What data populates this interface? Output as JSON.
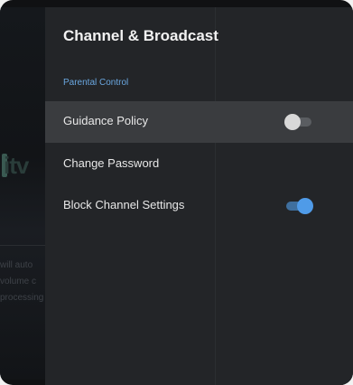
{
  "background": {
    "logo_text": "itv",
    "text_lines": [
      "will auto",
      "volume c",
      "processing"
    ]
  },
  "panel": {
    "title": "Channel & Broadcast",
    "section_label": "Parental Control",
    "items": [
      {
        "label": "Guidance Policy",
        "has_toggle": true,
        "toggle_on": false,
        "focused": true
      },
      {
        "label": "Change Password",
        "has_toggle": false,
        "focused": false
      },
      {
        "label": "Block Channel Settings",
        "has_toggle": true,
        "toggle_on": true,
        "focused": false
      }
    ]
  },
  "colors": {
    "accent": "#4f9be8",
    "section_label": "#6aa7e0",
    "panel_bg": "#232528",
    "focused_row": "#3a3c3f"
  }
}
